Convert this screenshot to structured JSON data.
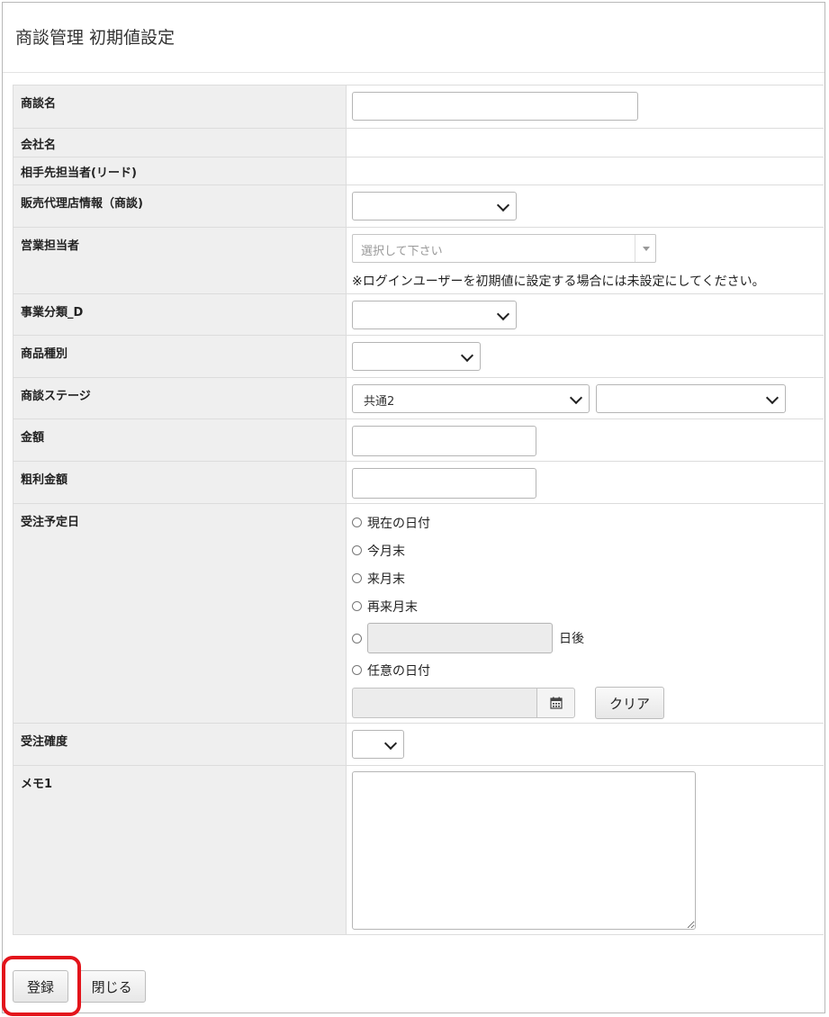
{
  "page": {
    "title": "商談管理 初期値設定"
  },
  "fields": {
    "deal_name": {
      "label": "商談名",
      "value": ""
    },
    "company_name": {
      "label": "会社名"
    },
    "contact_lead": {
      "label": "相手先担当者(リード)"
    },
    "agency_info": {
      "label": "販売代理店情報（商談)",
      "value": ""
    },
    "sales_rep": {
      "label": "営業担当者",
      "placeholder": "選択して下さい",
      "note": "※ログインユーザーを初期値に設定する場合には未設定にしてください。"
    },
    "business_category": {
      "label": "事業分類_D",
      "value": ""
    },
    "product_type": {
      "label": "商品種別",
      "value": ""
    },
    "deal_stage": {
      "label": "商談ステージ",
      "value_primary": "共通2",
      "value_secondary": ""
    },
    "amount": {
      "label": "金額",
      "value": ""
    },
    "gross_profit": {
      "label": "粗利金額",
      "value": ""
    },
    "order_date": {
      "label": "受注予定日",
      "options": [
        "現在の日付",
        "今月末",
        "来月末",
        "再来月末"
      ],
      "days_after_suffix": "日後",
      "any_date_label": "任意の日付",
      "clear_label": "クリア"
    },
    "order_probability": {
      "label": "受注確度",
      "value": ""
    },
    "memo1": {
      "label": "メモ1",
      "value": ""
    }
  },
  "footer": {
    "register_label": "登録",
    "close_label": "閉じる"
  },
  "colors": {
    "highlight": "#e3141b",
    "label_bg": "#efefef"
  },
  "icons": {
    "calendar": "calendar-icon",
    "dropdown": "chevron-down-icon"
  }
}
